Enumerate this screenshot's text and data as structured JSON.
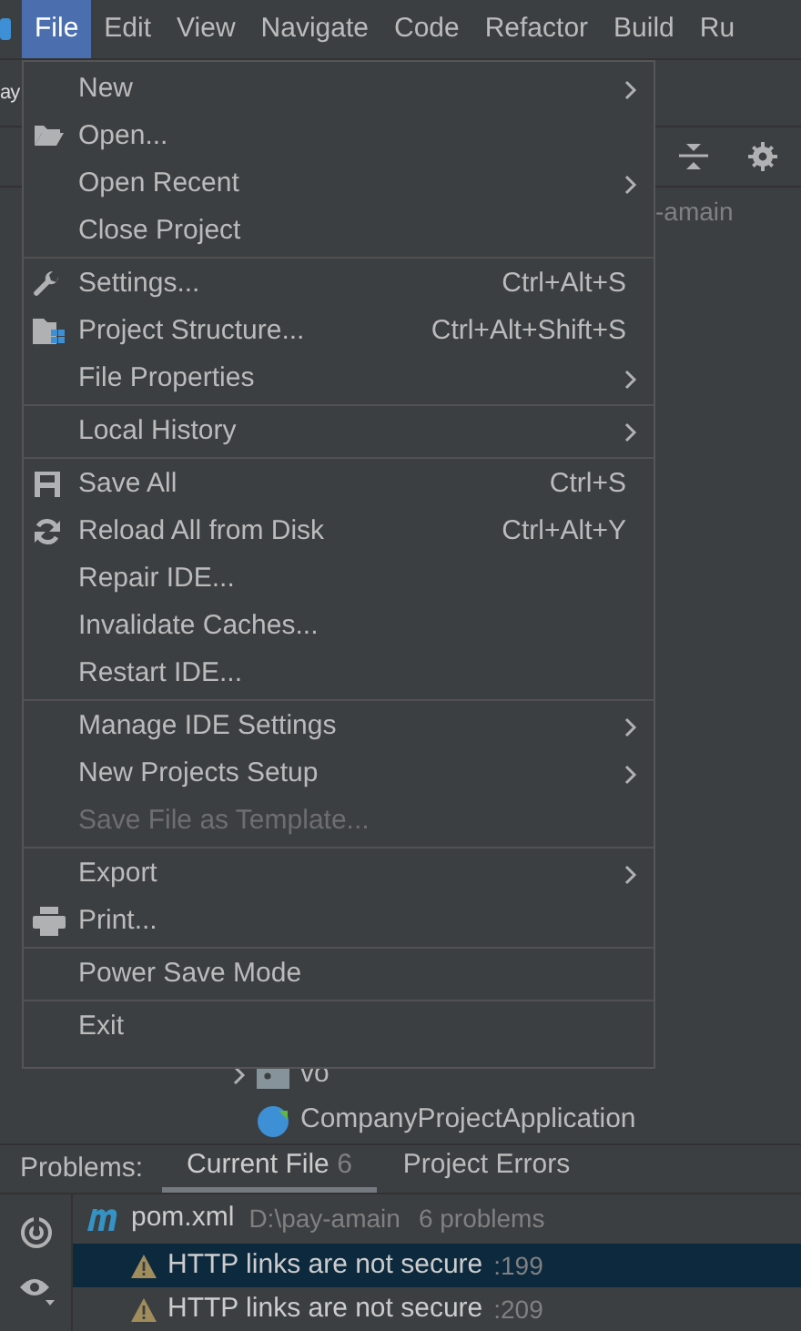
{
  "menu_bar": [
    {
      "label": "File",
      "selected": true
    },
    {
      "label": "Edit",
      "selected": false
    },
    {
      "label": "View",
      "selected": false
    },
    {
      "label": "Navigate",
      "selected": false
    },
    {
      "label": "Code",
      "selected": false
    },
    {
      "label": "Refactor",
      "selected": false
    },
    {
      "label": "Build",
      "selected": false
    },
    {
      "label": "Ru",
      "selected": false
    }
  ],
  "project_panel": {
    "tab_fragment": "ay",
    "path_fragment": "-amain",
    "tree": [
      {
        "label": "vo",
        "kind": "package"
      },
      {
        "label": "CompanyProjectApplication",
        "kind": "class"
      }
    ]
  },
  "file_menu": {
    "sections": [
      [
        {
          "label": "New",
          "submenu": true,
          "disabled": false
        },
        {
          "label": "Open...",
          "submenu": false,
          "disabled": false
        },
        {
          "label": "Open Recent",
          "submenu": true,
          "disabled": false
        },
        {
          "label": "Close Project",
          "submenu": false,
          "disabled": false
        }
      ],
      [
        {
          "label": "Settings...",
          "shortcut": "Ctrl+Alt+S",
          "submenu": false,
          "disabled": false
        },
        {
          "label": "Project Structure...",
          "shortcut": "Ctrl+Alt+Shift+S",
          "submenu": false,
          "disabled": false
        },
        {
          "label": "File Properties",
          "submenu": true,
          "disabled": false
        }
      ],
      [
        {
          "label": "Local History",
          "submenu": true,
          "disabled": false
        }
      ],
      [
        {
          "label": "Save All",
          "shortcut": "Ctrl+S",
          "submenu": false,
          "disabled": false
        },
        {
          "label": "Reload All from Disk",
          "shortcut": "Ctrl+Alt+Y",
          "submenu": false,
          "disabled": false
        },
        {
          "label": "Repair IDE...",
          "submenu": false,
          "disabled": false
        },
        {
          "label": "Invalidate Caches...",
          "submenu": false,
          "disabled": false
        },
        {
          "label": "Restart IDE...",
          "submenu": false,
          "disabled": false
        }
      ],
      [
        {
          "label": "Manage IDE Settings",
          "submenu": true,
          "disabled": false
        },
        {
          "label": "New Projects Setup",
          "submenu": true,
          "disabled": false
        },
        {
          "label": "Save File as Template...",
          "submenu": false,
          "disabled": true
        }
      ],
      [
        {
          "label": "Export",
          "submenu": true,
          "disabled": false
        },
        {
          "label": "Print...",
          "submenu": false,
          "disabled": false
        }
      ],
      [
        {
          "label": "Power Save Mode",
          "submenu": false,
          "disabled": false
        }
      ],
      [
        {
          "label": "Exit",
          "submenu": false,
          "disabled": false
        }
      ]
    ]
  },
  "problems": {
    "title": "Problems:",
    "tabs": [
      {
        "label": "Current File",
        "count": "6",
        "selected": true
      },
      {
        "label": "Project Errors",
        "selected": false
      }
    ],
    "file": {
      "name": "pom.xml",
      "path": "D:\\pay-amain",
      "summary": "6 problems"
    },
    "items": [
      {
        "message": "HTTP links are not secure",
        "line": ":199",
        "selected": true
      },
      {
        "message": "HTTP links are not secure",
        "line": ":209",
        "selected": false
      }
    ]
  }
}
